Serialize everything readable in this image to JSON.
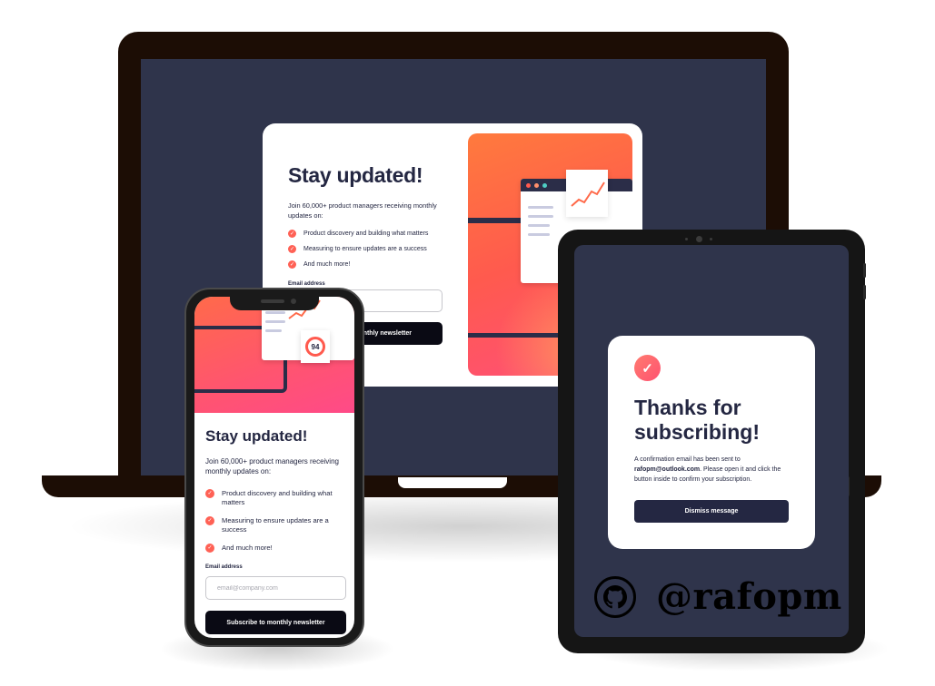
{
  "laptop": {
    "title": "Stay updated!",
    "intro": "Join 60,000+ product managers receiving monthly updates on:",
    "features": [
      "Product discovery and building what matters",
      "Measuring to ensure updates are a success",
      "And much more!"
    ],
    "email_label": "Email address",
    "button_label": "monthly newsletter"
  },
  "phone": {
    "title": "Stay updated!",
    "intro": "Join 60,000+ product managers receiving monthly updates on:",
    "features": [
      "Product discovery and building what matters",
      "Measuring to ensure updates are a success",
      "And much more!"
    ],
    "email_label": "Email address",
    "email_placeholder": "email@company.com",
    "button_label": "Subscribe to monthly newsletter",
    "score": "94"
  },
  "tablet": {
    "title": "Thanks for subscribing!",
    "text_before": "A confirmation email has been sent to",
    "email": "rafopm@outlook.com",
    "text_after": ". Please open it and click the button inside to confirm your subscription.",
    "button_label": "Dismiss message",
    "handle": "@rafopm"
  },
  "colors": {
    "navy": "#242742",
    "slate": "#2f344b",
    "tomato": "#ff6155",
    "white": "#ffffff"
  },
  "icons": [
    "check-icon",
    "github-icon"
  ]
}
